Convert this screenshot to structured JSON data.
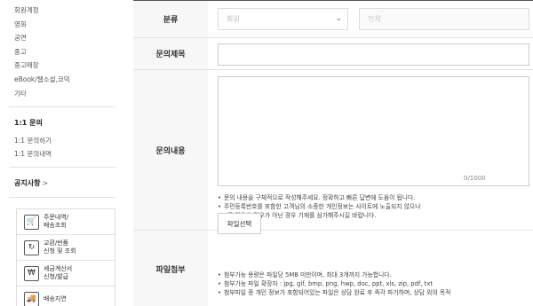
{
  "sidebar": {
    "top_items": [
      "회원계정",
      "영화",
      "공연",
      "중고",
      "중고매장",
      "eBook/웹소설,코믹",
      "기타"
    ],
    "inquiry_title": "1:1 문의",
    "inquiry_items": [
      "1:1 문의하기",
      "1:1 문의내역"
    ],
    "notice": "공지사항",
    "notice_chevron": ">",
    "quick_links": [
      {
        "icon": "🛒",
        "icon_name": "cart-icon",
        "label": "주문내역/\n배송조회"
      },
      {
        "icon": "↻",
        "icon_name": "exchange-icon",
        "label": "교환/반품\n신청 및 조회"
      },
      {
        "icon": "₩",
        "icon_name": "tax-invoice-icon",
        "label": "세금계산서\n신청/발급"
      },
      {
        "icon": "🚚",
        "icon_name": "delivery-delay-icon",
        "label": "배송지연"
      }
    ]
  },
  "form": {
    "category_label": "분류",
    "category_value": "회원",
    "subcategory_value": "전체",
    "title_label": "문의제목",
    "title_value": "",
    "content_label": "문의내용",
    "content_value": "",
    "counter": "0/1000",
    "content_notes": [
      "문의 내용을 구체적으로 작성해주세요. 정확하고 빠른 답변에 도움이 됩니다.",
      "주민등록번호를 포함한 고객님의 소중한 개인정보는 사이트에 노출되지 않으나",
      "꼭 필요한 경우가 아닌 경우 기재를 삼가해주시길 바랍니다."
    ],
    "attach_label": "파일첨부",
    "attach_button": "파일선택",
    "attach_notes": [
      "첨부가능 용량은 파일당 5MB 미만이며, 최대 3개까지 가능합니다.",
      "첨부가능 파일 확장자 : jpg, gif, bmp, png, hwp, doc, ppt, xls, zip, pdf, txt",
      "첨부파일 중 개인 정보가 포함되어있는 파일은 상담 완료 후 즉각 파기하며, 상담 외의 목적"
    ]
  }
}
